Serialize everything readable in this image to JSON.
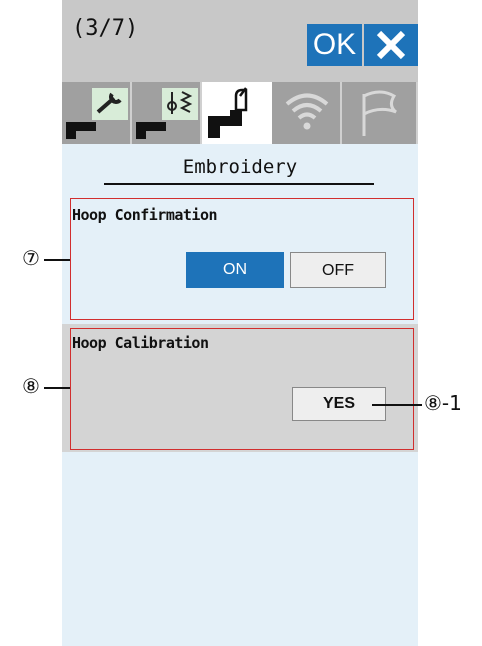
{
  "header": {
    "page_indicator": "(3/7)",
    "ok_label": "OK",
    "close_icon": "close-x-icon"
  },
  "tabs": [
    {
      "icon": "wrench-machine-icon",
      "active": false
    },
    {
      "icon": "stitch-machine-icon",
      "active": false
    },
    {
      "icon": "embroidery-machine-icon",
      "active": true
    },
    {
      "icon": "wifi-icon",
      "active": false
    },
    {
      "icon": "flag-icon",
      "active": false
    }
  ],
  "section": {
    "title": "Embroidery"
  },
  "hoop_confirmation": {
    "label": "Hoop Confirmation",
    "on_label": "ON",
    "off_label": "OFF",
    "selected": "ON"
  },
  "hoop_calibration": {
    "label": "Hoop Calibration",
    "yes_label": "YES"
  },
  "callouts": {
    "c7": "⑦",
    "c8": "⑧",
    "c8_1": "⑧-1"
  },
  "colors": {
    "accent": "#1e73b9",
    "annotation": "#d12e2e"
  }
}
